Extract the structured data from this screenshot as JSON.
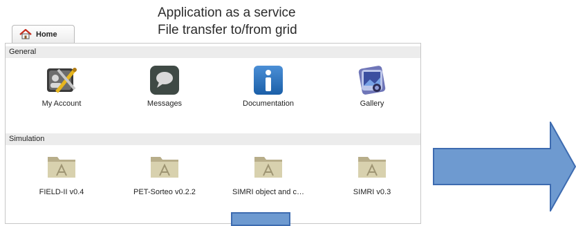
{
  "caption": {
    "line1": "Application as a service",
    "line2": "File transfer to/from grid"
  },
  "tab": {
    "label": "Home",
    "icon": "home-icon"
  },
  "sections": [
    {
      "title": "General",
      "items": [
        {
          "label": "My Account",
          "icon": "account-icon"
        },
        {
          "label": "Messages",
          "icon": "messages-icon"
        },
        {
          "label": "Documentation",
          "icon": "documentation-icon"
        },
        {
          "label": "Gallery",
          "icon": "gallery-icon"
        }
      ]
    },
    {
      "title": "Simulation",
      "items": [
        {
          "label": "FIELD-II v0.4",
          "icon": "app-folder-icon"
        },
        {
          "label": "PET-Sorteo v0.2.2",
          "icon": "app-folder-icon"
        },
        {
          "label": "SIMRI object and c…",
          "icon": "app-folder-icon"
        },
        {
          "label": "SIMRI v0.3",
          "icon": "app-folder-icon"
        }
      ]
    }
  ],
  "colors": {
    "arrow": "#6e9ad0",
    "arrow_border": "#3d6bb0",
    "section_bg": "#ececec"
  }
}
